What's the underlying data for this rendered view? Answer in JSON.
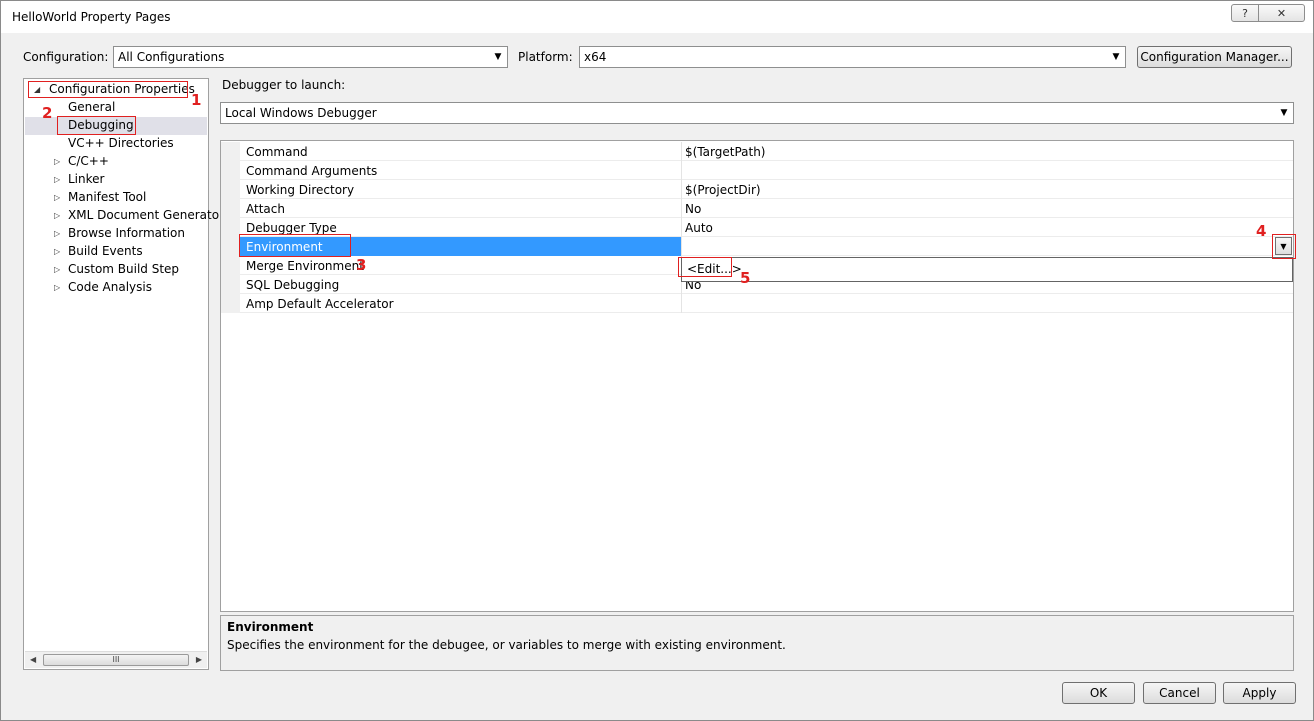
{
  "window": {
    "title": "HelloWorld Property Pages",
    "help_glyph": "?",
    "close_glyph": "✕"
  },
  "config_bar": {
    "configuration_label": "Configuration:",
    "configuration_value": "All Configurations",
    "platform_label": "Platform:",
    "platform_value": "x64",
    "config_manager_label": "Configuration Manager..."
  },
  "tree": {
    "root": "Configuration Properties",
    "items": [
      {
        "label": "General"
      },
      {
        "label": "Debugging"
      },
      {
        "label": "VC++ Directories"
      },
      {
        "label": "C/C++"
      },
      {
        "label": "Linker"
      },
      {
        "label": "Manifest Tool"
      },
      {
        "label": "XML Document Generator"
      },
      {
        "label": "Browse Information"
      },
      {
        "label": "Build Events"
      },
      {
        "label": "Custom Build Step"
      },
      {
        "label": "Code Analysis"
      }
    ],
    "scroll_thumb_glyph": "III"
  },
  "debugger": {
    "label": "Debugger to launch:",
    "value": "Local Windows Debugger"
  },
  "properties": [
    {
      "name": "Command",
      "value": "$(TargetPath)"
    },
    {
      "name": "Command Arguments",
      "value": ""
    },
    {
      "name": "Working Directory",
      "value": "$(ProjectDir)"
    },
    {
      "name": "Attach",
      "value": "No"
    },
    {
      "name": "Debugger Type",
      "value": "Auto"
    },
    {
      "name": "Environment",
      "value": ""
    },
    {
      "name": "Merge Environment",
      "value": ""
    },
    {
      "name": "SQL Debugging",
      "value": "No"
    },
    {
      "name": "Amp Default Accelerator",
      "value": ""
    }
  ],
  "dropdown": {
    "item": "<Edit...>"
  },
  "description": {
    "title": "Environment",
    "text": "Specifies the environment for the debugee, or variables to merge with existing environment."
  },
  "buttons": {
    "ok": "OK",
    "cancel": "Cancel",
    "apply": "Apply"
  },
  "annotations": {
    "n1": "1",
    "n2": "2",
    "n3": "3",
    "n4": "4",
    "n5": "5",
    "color": "#e02020"
  }
}
